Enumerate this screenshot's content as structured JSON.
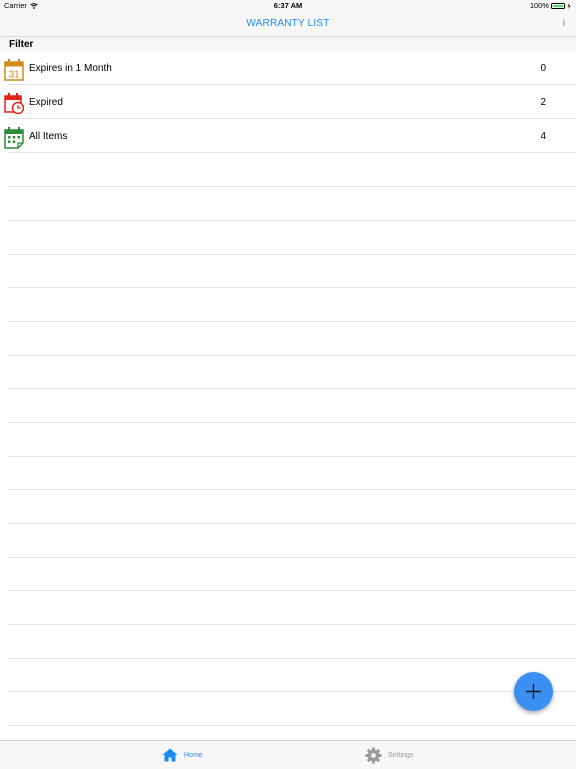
{
  "status_bar": {
    "carrier": "Carrier",
    "time": "6:37 AM",
    "battery": "100%"
  },
  "nav": {
    "title": "WARRANTY LIST",
    "info_label": "i"
  },
  "section": {
    "title": "Filter"
  },
  "filters": [
    {
      "label": "Expires in 1 Month",
      "count": "0",
      "icon": "calendar-31-icon",
      "icon_text": "31",
      "color": "#d08a1e"
    },
    {
      "label": "Expired",
      "count": "2",
      "icon": "calendar-clock-icon",
      "color": "#e2231a"
    },
    {
      "label": "All Items",
      "count": "4",
      "icon": "calendar-grid-icon",
      "color": "#2e8b3a"
    }
  ],
  "fab": {
    "icon": "plus-icon",
    "color": "#3b8ff0"
  },
  "tab_bar": {
    "tabs": [
      {
        "label": "Home",
        "icon": "home-icon",
        "active": true,
        "color": "#1a8cf5"
      },
      {
        "label": "Settings",
        "icon": "gear-icon",
        "active": false,
        "color": "#9a9a9a"
      }
    ]
  }
}
